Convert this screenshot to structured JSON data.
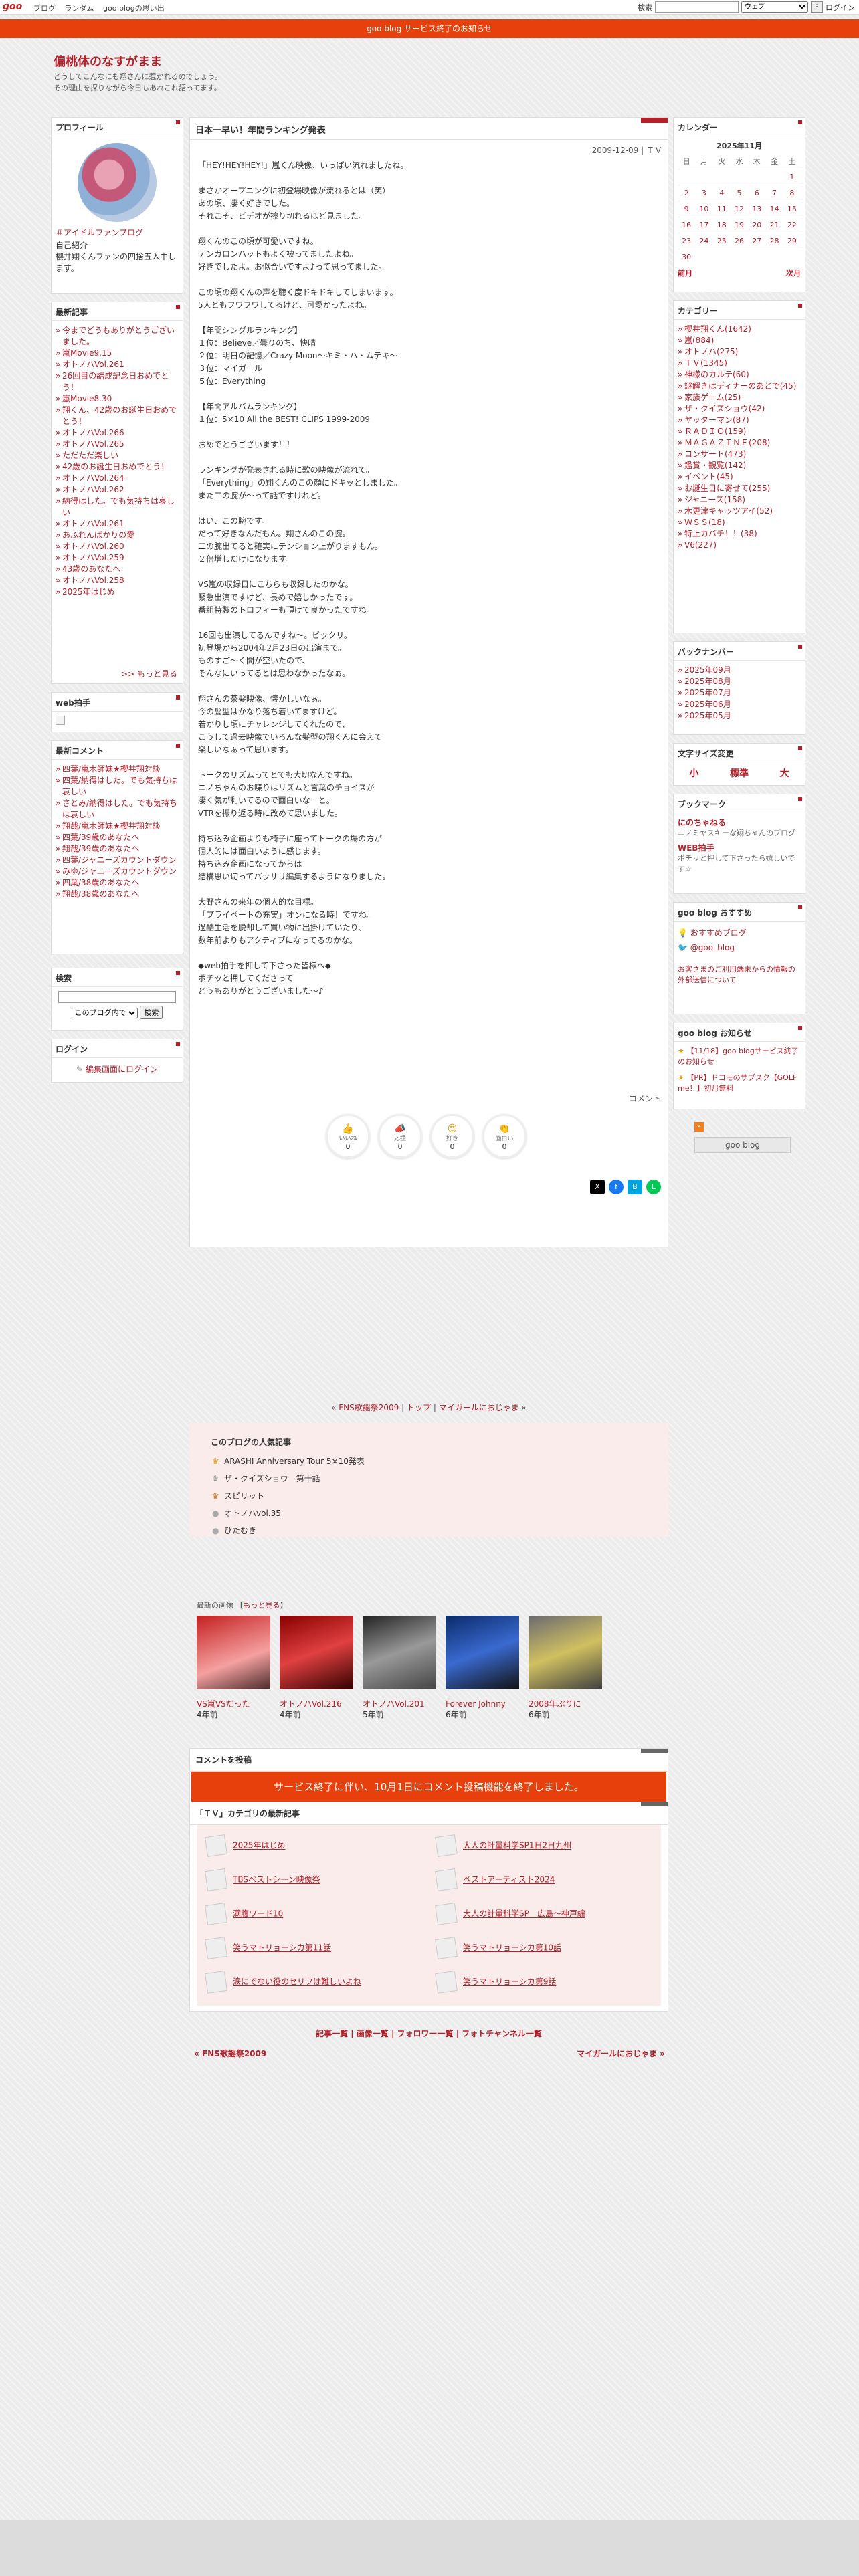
{
  "topbar": {
    "logo": "goo",
    "nav": [
      "ブログ",
      "ランダム",
      "goo blogの思い出"
    ],
    "search_label": "検索",
    "search_select": "ウェブ",
    "login": "ログイン"
  },
  "banner": "goo blog サービス終了のお知らせ",
  "site": {
    "title": "偏桃体のなすがまま",
    "desc1": "どうしてこんなにも翔さんに惹かれるのでしょう。",
    "desc2": "その理由を探りながら今日もあれこれ語ってます。"
  },
  "profile": {
    "heading": "プロフィール",
    "link": "＃アイドルファンブログ",
    "intro_label": "自己紹介",
    "intro": "櫻井翔くんファンの四捨五入中します。"
  },
  "recent": {
    "heading": "最新記事",
    "items": [
      "今までどうもありがとうございました。",
      "嵐Movie9.15",
      "オトノハVol.261",
      "26回目の結成記念日おめでとう！",
      "嵐Movie8.30",
      "翔くん、42歳のお誕生日おめでとう！",
      "オトノハVol.266",
      "オトノハVol.265",
      "ただただ楽しい",
      "42歳のお誕生日おめでとう！",
      "オトノハVol.264",
      "オトノハVol.262",
      "納得はした。でも気持ちは哀しい",
      "オトノハVol.261",
      "あふれんばかりの愛",
      "オトノハVol.260",
      "オトノハVol.259",
      "43歳のあなたへ",
      "オトノハVol.258",
      "2025年はじめ"
    ],
    "more": ">> もっと見る"
  },
  "web_clap": {
    "heading": "web拍手"
  },
  "comments": {
    "heading": "最新コメント",
    "items": [
      "四葉/嵐木師妹★櫻井翔対談",
      "四葉/納得はした。でも気持ちは哀しい",
      "さとみ/納得はした。でも気持ちは哀しい",
      "翔哉/嵐木師妹★櫻井翔対談",
      "四葉/39歳のあなたへ",
      "翔哉/39歳のあなたへ",
      "四葉/ジャニーズカウントダウン",
      "みゆ/ジャニーズカウントダウン",
      "四葉/38歳のあなたへ",
      "翔哉/38歳のあなたへ"
    ]
  },
  "search": {
    "heading": "検索",
    "select": "このブログ内で",
    "button": "検索"
  },
  "login": {
    "heading": "ログイン",
    "link": "編集画面にログイン"
  },
  "entry": {
    "title": "日本一早い！年間ランキング発表",
    "date": "2009-12-09 | ＴＶ",
    "paragraphs": [
      "「HEY!HEY!HEY!」嵐くん映像、いっぱい流れましたね。",
      "",
      "まさかオープニングに初登場映像が流れるとは（笑）",
      "あの頃、凄く好きでした。",
      "それこそ、ビデオが擦り切れるほど見ました。",
      "",
      "翔くんのこの頃が可愛いですね。",
      "テンガロンハットもよく被ってましたよね。",
      "好きでしたよ。お似合いですよ♪って思ってました。",
      "",
      "この頃の翔くんの声を聴く度ドキドキしてしまいます。",
      "5人ともフワフワしてるけど、可愛かったよね。",
      "",
      "【年間シングルランキング】",
      "１位：Believe／曇りのち、快晴",
      "２位：明日の記憶／Crazy Moon～キミ・ハ・ムテキ～",
      "３位：マイガール",
      "５位：Everything",
      "",
      "【年間アルバムランキング】",
      "１位：5×10 All the BEST! CLIPS 1999-2009",
      "",
      "おめでとうございます！！",
      "",
      "ランキングが発表される時に歌の映像が流れて。",
      "「Everything」の翔くんのこの顔にドキッとしました。",
      "また二の腕が～って話ですけれど。",
      "",
      "はい、この腕です。",
      "だって好きなんだもん。翔さんのこの腕。",
      "二の腕出てると確実にテンション上がりますもん。",
      "２倍増しだけになります。",
      "",
      "VS嵐の収録日にこちらも収録したのかな。",
      "緊急出演ですけど、長めで嬉しかったです。",
      "番組特製のトロフィーも頂けて良かったですね。",
      "",
      "16回も出演してるんですね～。ビックリ。",
      "初登場から2004年2月23日の出演まで。",
      "ものすご～く間が空いたので、",
      "そんなにいってるとは思わなかったなぁ。",
      "",
      "翔さんの茶髪映像、懐かしいなぁ。",
      "今の髪型はかなり落ち着いてますけど。",
      "若かりし頃にチャレンジしてくれたので、",
      "こうして過去映像でいろんな髪型の翔くんに会えて",
      "楽しいなぁって思います。",
      "",
      "トークのリズムってとても大切なんですね。",
      "ニノちゃんのお喋りはリズムと言葉のチョイスが",
      "凄く気が利いてるので面白いなーと。",
      "VTRを振り返る時に改めて思いました。",
      "",
      "持ち込み企画よりも椅子に座ってトークの場の方が",
      "個人的には面白いように感じます。",
      "持ち込み企画になってからは",
      "結構思い切ってバッサリ編集するようになりました。",
      "",
      "大野さんの来年の個人的な目標。",
      "「プライベートの充実」オンになる時！ですね。",
      "過酷生活を脱却して買い物に出掛けていたり、",
      "数年前よりもアクティブになってるのかな。",
      "",
      "◆web拍手を押して下さった皆様へ◆",
      "ポチッと押してくださって",
      "どうもありがとうございました～♪"
    ],
    "comment_label": "コメント",
    "reactions": [
      {
        "label": "いいね",
        "count": "0"
      },
      {
        "label": "応援",
        "count": "0"
      },
      {
        "label": "好き",
        "count": "0"
      },
      {
        "label": "面白い",
        "count": "0"
      }
    ]
  },
  "pager": {
    "prev": "FNS歌謡祭2009",
    "top": "トップ",
    "next": "マイガールにおじゃま"
  },
  "popular": {
    "heading": "このブログの人気記事",
    "items": [
      "ARASHI Anniversary Tour 5×10発表",
      "ザ・クイズショウ　第十話",
      "スピリット",
      "オトノハvol.35",
      "ひたむき"
    ]
  },
  "gallery": {
    "title": "最新の画像",
    "more": "もっと見る",
    "items": [
      {
        "caption": "VS嵐VSだった",
        "ago": "4年前"
      },
      {
        "caption": "オトノハVol.216",
        "ago": "4年前"
      },
      {
        "caption": "オトノハVol.201",
        "ago": "5年前"
      },
      {
        "caption": "Forever Johnny",
        "ago": "6年前"
      },
      {
        "caption": "2008年ぶりに",
        "ago": "6年前"
      }
    ]
  },
  "comment_post": {
    "heading": "コメントを投稿",
    "notice": "サービス終了に伴い、10月1日にコメント投稿機能を終了しました。"
  },
  "tv_recent": {
    "heading": "「ＴＶ」カテゴリの最新記事",
    "left": [
      "2025年はじめ",
      "TBSベストシーン映像祭",
      "满腹ワード10",
      "笑うマトリョーシカ第11話",
      "涙にでない役のセリフは難しいよね"
    ],
    "right": [
      "大人の計量科学SP1日2日九州",
      "ベストアーティスト2024",
      "大人の計量科学SP　広島～神戸編",
      "笑うマトリョーシカ第10話",
      "笑うマトリョーシカ第9話"
    ]
  },
  "footer_links": "記事一覧 | 画像一覧 | フォロワー一覧 | フォトチャンネル一覧",
  "footer_prev": "« FNS歌謡祭2009",
  "footer_next": "マイガールにおじゃま »",
  "calendar": {
    "heading": "カレンダー",
    "month": "2025年11月",
    "weekdays": [
      "日",
      "月",
      "火",
      "水",
      "木",
      "金",
      "土"
    ],
    "weeks": [
      [
        "",
        "",
        "",
        "",
        "",
        "",
        "1"
      ],
      [
        "2",
        "3",
        "4",
        "5",
        "6",
        "7",
        "8"
      ],
      [
        "9",
        "10",
        "11",
        "12",
        "13",
        "14",
        "15"
      ],
      [
        "16",
        "17",
        "18",
        "19",
        "20",
        "21",
        "22"
      ],
      [
        "23",
        "24",
        "25",
        "26",
        "27",
        "28",
        "29"
      ],
      [
        "30",
        "",
        "",
        "",
        "",
        "",
        ""
      ]
    ],
    "prev": "前月",
    "next": "次月"
  },
  "categories": {
    "heading": "カテゴリー",
    "items": [
      "櫻井翔くん(1642)",
      "嵐(884)",
      "オトノハ(275)",
      "ＴＶ(1345)",
      "神様のカルテ(60)",
      "謎解きはディナーのあとで(45)",
      "家族ゲーム(25)",
      "ザ・クイズショウ(42)",
      "ヤッターマン(87)",
      "ＲＡＤＩＯ(159)",
      "ＭＡＧＡＺＩＮＥ(208)",
      "コンサート(473)",
      "鑑賞・観覧(142)",
      "イベント(45)",
      "お誕生日に寄せて(255)",
      "ジャニーズ(158)",
      "木更津キャッツアイ(52)",
      "ＷＳＳ(18)",
      "特上カバチ！！(38)",
      "V6(227)"
    ]
  },
  "backnumber": {
    "heading": "バックナンバー",
    "items": [
      "2025年09月",
      "2025年08月",
      "2025年07月",
      "2025年06月",
      "2025年05月"
    ]
  },
  "fontsize": {
    "heading": "文字サイズ変更",
    "small": "小",
    "mid": "標準",
    "large": "大"
  },
  "bookmark": {
    "heading": "ブックマーク",
    "items": [
      {
        "name": "にのちゃねる",
        "desc": "ニノミヤスキーな翔ちゃんのブログ"
      },
      {
        "name": "WEB拍手",
        "desc": "ポチッと押して下さったら嬉しいです☆"
      }
    ]
  },
  "recommend": {
    "heading": "goo blog おすすめ",
    "items": [
      "おすすめブログ",
      "@goo_blog"
    ],
    "note": "お客さまのご利用端末からの情報の外部送信について"
  },
  "notice": {
    "heading": "goo blog お知らせ",
    "items": [
      "【11/18】goo blogサービス終了のお知らせ",
      "【PR】ドコモのサブスク【GOLF me！】初月無料"
    ]
  },
  "goo_badge": "goo blog"
}
